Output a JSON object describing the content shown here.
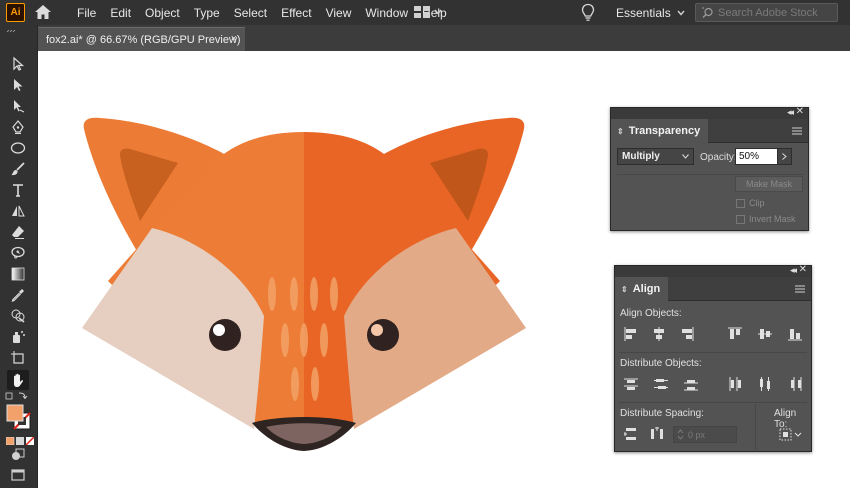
{
  "app": {
    "logo": "Ai",
    "brand_color": "#ff9a00"
  },
  "menu": [
    "File",
    "Edit",
    "Object",
    "Type",
    "Select",
    "Effect",
    "View",
    "Window",
    "Help"
  ],
  "workspace": {
    "label": "Essentials"
  },
  "search": {
    "placeholder": "Search Adobe Stock"
  },
  "document": {
    "tab_title": "fox2.ai* @ 66.67% (RGB/GPU Preview)",
    "close": "×"
  },
  "toolbar": {
    "tools": [
      "selection-tool",
      "direct-selection-tool",
      "pen-tool",
      "curvature-tool",
      "ellipse-tool",
      "paintbrush-tool",
      "type-tool",
      "reflect-tool",
      "eraser-tool",
      "lasso-tool",
      "gradient-tool",
      "eyedropper-tool",
      "shape-builder-tool",
      "symbol-sprayer-tool",
      "artboard-tool",
      "hand-tool"
    ],
    "fill_color": "#f2a16b"
  },
  "transparency": {
    "title": "Transparency",
    "blend_mode": "Multiply",
    "opacity_label": "Opacity:",
    "opacity_value": "50%",
    "make_mask": "Make Mask",
    "clip": "Clip",
    "invert_mask": "Invert Mask"
  },
  "align": {
    "title": "Align",
    "align_objects": "Align Objects:",
    "distribute_objects": "Distribute Objects:",
    "distribute_spacing": "Distribute Spacing:",
    "align_to": "Align To:",
    "spacing_value": "0 px"
  },
  "fox_colors": {
    "ear_outer": "#ec7c35",
    "ear_inner": "#c8601f",
    "head_left": "#ed7d36",
    "head_right": "#e86526",
    "cheek_left": "#e6cfc0",
    "cheek_right": "#e3aa88",
    "nose": "#2e2421",
    "snout": "#7d6461"
  }
}
